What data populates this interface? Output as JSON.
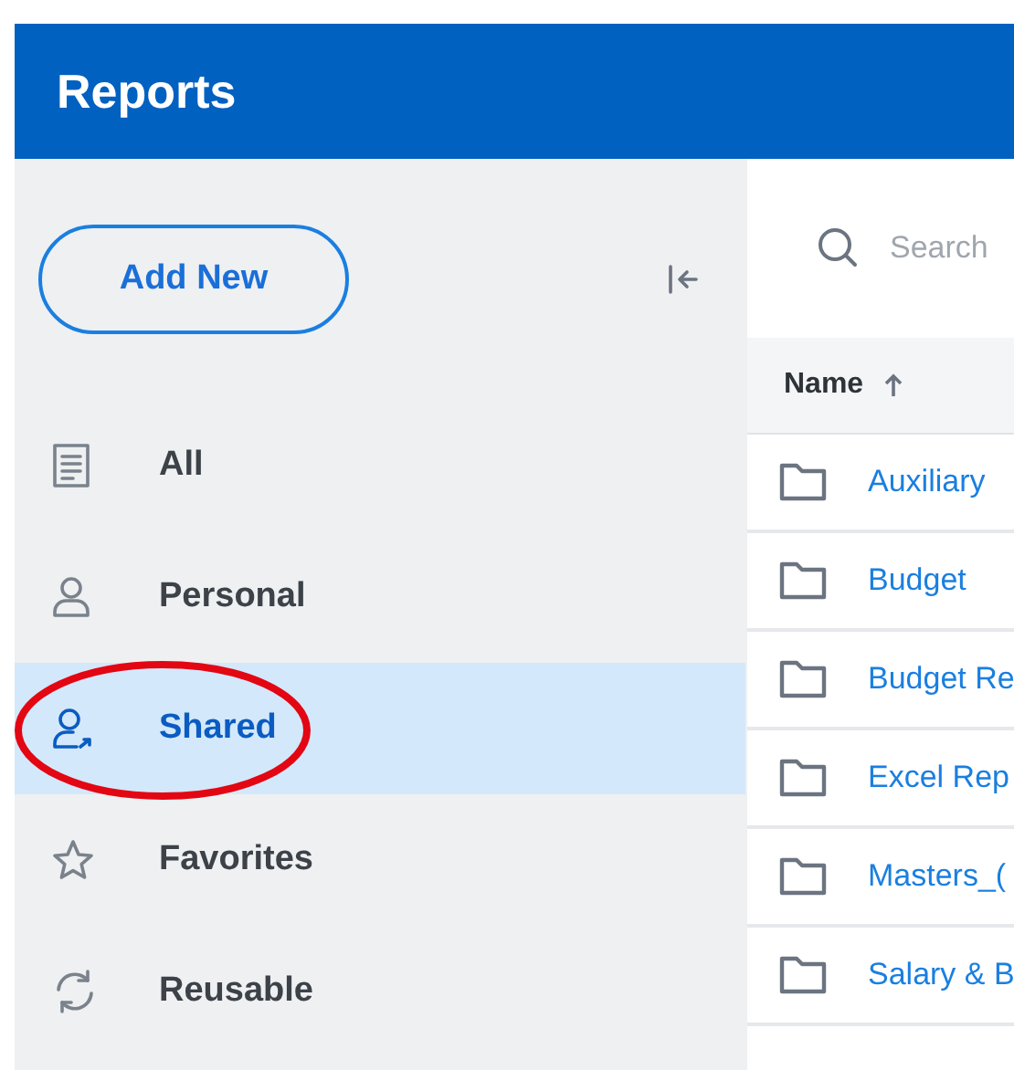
{
  "header": {
    "title": "Reports"
  },
  "sidebar": {
    "add_button": "Add New",
    "items": [
      {
        "label": "All",
        "kind": "document",
        "selected": false
      },
      {
        "label": "Personal",
        "kind": "person",
        "selected": false
      },
      {
        "label": "Shared",
        "kind": "shared",
        "selected": true
      },
      {
        "label": "Favorites",
        "kind": "star",
        "selected": false
      },
      {
        "label": "Reusable",
        "kind": "refresh",
        "selected": false
      }
    ]
  },
  "annotation": {
    "kind": "ellipse",
    "color": "#e30613"
  },
  "search": {
    "placeholder": "Search"
  },
  "table": {
    "columns": [
      {
        "label": "Name",
        "sorted": true
      }
    ],
    "rows": [
      {
        "name": "Auxiliary"
      },
      {
        "name": "Budget"
      },
      {
        "name": "Budget Re"
      },
      {
        "name": "Excel Rep"
      },
      {
        "name": "Masters_("
      },
      {
        "name": "Salary & B"
      }
    ]
  }
}
